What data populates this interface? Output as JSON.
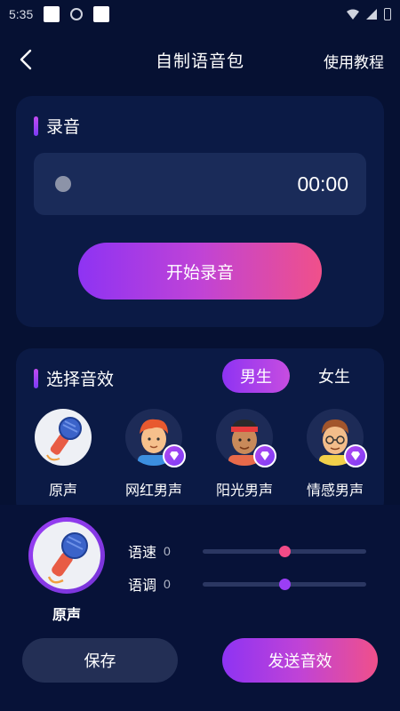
{
  "status_bar": {
    "time": "5:35"
  },
  "nav": {
    "title": "自制语音包",
    "tutorial": "使用教程"
  },
  "recording": {
    "section_title": "录音",
    "timer": "00:00",
    "start_button": "开始录音"
  },
  "effects": {
    "section_title": "选择音效",
    "tabs": [
      {
        "label": "男生",
        "active": true
      },
      {
        "label": "女生",
        "active": false
      }
    ],
    "voices": [
      {
        "label": "原声",
        "icon": "microphone-icon",
        "badge": false
      },
      {
        "label": "网红男声",
        "icon": "avatar-red-hair",
        "badge": true
      },
      {
        "label": "阳光男声",
        "icon": "avatar-headband",
        "badge": true
      },
      {
        "label": "情感男声",
        "icon": "avatar-glasses",
        "badge": true
      }
    ]
  },
  "selected": {
    "label": "原声"
  },
  "sliders": [
    {
      "label": "语速",
      "value": "0",
      "level": 0.5,
      "color": "#f14b87"
    },
    {
      "label": "语调",
      "value": "0",
      "level": 0.5,
      "color": "#9b3ef5"
    }
  ],
  "actions": {
    "save": "保存",
    "send": "发送音效"
  },
  "colors": {
    "background": "#061133",
    "card": "#0b1a45",
    "accent_purple": "#8e33f3",
    "accent_pink": "#f0508a"
  }
}
